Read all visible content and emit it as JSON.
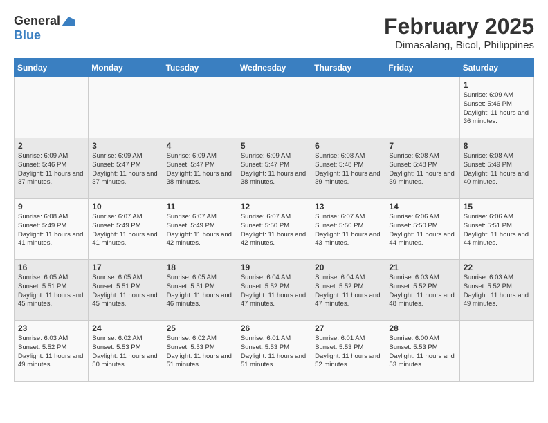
{
  "logo": {
    "general": "General",
    "blue": "Blue"
  },
  "title": "February 2025",
  "location": "Dimasalang, Bicol, Philippines",
  "days_of_week": [
    "Sunday",
    "Monday",
    "Tuesday",
    "Wednesday",
    "Thursday",
    "Friday",
    "Saturday"
  ],
  "weeks": [
    [
      {
        "day": "",
        "info": ""
      },
      {
        "day": "",
        "info": ""
      },
      {
        "day": "",
        "info": ""
      },
      {
        "day": "",
        "info": ""
      },
      {
        "day": "",
        "info": ""
      },
      {
        "day": "",
        "info": ""
      },
      {
        "day": "1",
        "info": "Sunrise: 6:09 AM\nSunset: 5:46 PM\nDaylight: 11 hours and 36 minutes."
      }
    ],
    [
      {
        "day": "2",
        "info": "Sunrise: 6:09 AM\nSunset: 5:46 PM\nDaylight: 11 hours and 37 minutes."
      },
      {
        "day": "3",
        "info": "Sunrise: 6:09 AM\nSunset: 5:47 PM\nDaylight: 11 hours and 37 minutes."
      },
      {
        "day": "4",
        "info": "Sunrise: 6:09 AM\nSunset: 5:47 PM\nDaylight: 11 hours and 38 minutes."
      },
      {
        "day": "5",
        "info": "Sunrise: 6:09 AM\nSunset: 5:47 PM\nDaylight: 11 hours and 38 minutes."
      },
      {
        "day": "6",
        "info": "Sunrise: 6:08 AM\nSunset: 5:48 PM\nDaylight: 11 hours and 39 minutes."
      },
      {
        "day": "7",
        "info": "Sunrise: 6:08 AM\nSunset: 5:48 PM\nDaylight: 11 hours and 39 minutes."
      },
      {
        "day": "8",
        "info": "Sunrise: 6:08 AM\nSunset: 5:49 PM\nDaylight: 11 hours and 40 minutes."
      }
    ],
    [
      {
        "day": "9",
        "info": "Sunrise: 6:08 AM\nSunset: 5:49 PM\nDaylight: 11 hours and 41 minutes."
      },
      {
        "day": "10",
        "info": "Sunrise: 6:07 AM\nSunset: 5:49 PM\nDaylight: 11 hours and 41 minutes."
      },
      {
        "day": "11",
        "info": "Sunrise: 6:07 AM\nSunset: 5:49 PM\nDaylight: 11 hours and 42 minutes."
      },
      {
        "day": "12",
        "info": "Sunrise: 6:07 AM\nSunset: 5:50 PM\nDaylight: 11 hours and 42 minutes."
      },
      {
        "day": "13",
        "info": "Sunrise: 6:07 AM\nSunset: 5:50 PM\nDaylight: 11 hours and 43 minutes."
      },
      {
        "day": "14",
        "info": "Sunrise: 6:06 AM\nSunset: 5:50 PM\nDaylight: 11 hours and 44 minutes."
      },
      {
        "day": "15",
        "info": "Sunrise: 6:06 AM\nSunset: 5:51 PM\nDaylight: 11 hours and 44 minutes."
      }
    ],
    [
      {
        "day": "16",
        "info": "Sunrise: 6:05 AM\nSunset: 5:51 PM\nDaylight: 11 hours and 45 minutes."
      },
      {
        "day": "17",
        "info": "Sunrise: 6:05 AM\nSunset: 5:51 PM\nDaylight: 11 hours and 45 minutes."
      },
      {
        "day": "18",
        "info": "Sunrise: 6:05 AM\nSunset: 5:51 PM\nDaylight: 11 hours and 46 minutes."
      },
      {
        "day": "19",
        "info": "Sunrise: 6:04 AM\nSunset: 5:52 PM\nDaylight: 11 hours and 47 minutes."
      },
      {
        "day": "20",
        "info": "Sunrise: 6:04 AM\nSunset: 5:52 PM\nDaylight: 11 hours and 47 minutes."
      },
      {
        "day": "21",
        "info": "Sunrise: 6:03 AM\nSunset: 5:52 PM\nDaylight: 11 hours and 48 minutes."
      },
      {
        "day": "22",
        "info": "Sunrise: 6:03 AM\nSunset: 5:52 PM\nDaylight: 11 hours and 49 minutes."
      }
    ],
    [
      {
        "day": "23",
        "info": "Sunrise: 6:03 AM\nSunset: 5:52 PM\nDaylight: 11 hours and 49 minutes."
      },
      {
        "day": "24",
        "info": "Sunrise: 6:02 AM\nSunset: 5:53 PM\nDaylight: 11 hours and 50 minutes."
      },
      {
        "day": "25",
        "info": "Sunrise: 6:02 AM\nSunset: 5:53 PM\nDaylight: 11 hours and 51 minutes."
      },
      {
        "day": "26",
        "info": "Sunrise: 6:01 AM\nSunset: 5:53 PM\nDaylight: 11 hours and 51 minutes."
      },
      {
        "day": "27",
        "info": "Sunrise: 6:01 AM\nSunset: 5:53 PM\nDaylight: 11 hours and 52 minutes."
      },
      {
        "day": "28",
        "info": "Sunrise: 6:00 AM\nSunset: 5:53 PM\nDaylight: 11 hours and 53 minutes."
      },
      {
        "day": "",
        "info": ""
      }
    ]
  ]
}
